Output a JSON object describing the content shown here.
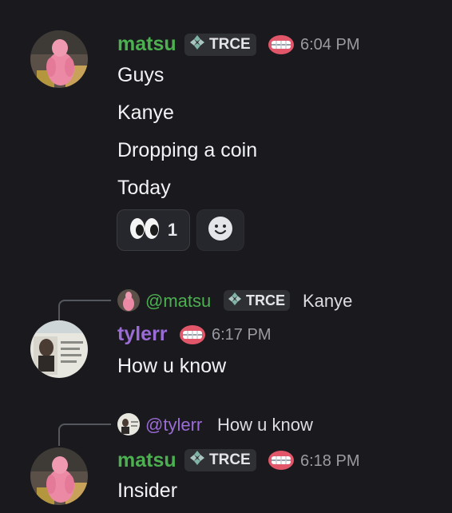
{
  "messages": [
    {
      "username": "matsu",
      "tag": "TRCE",
      "time": "6:04 PM",
      "lines": [
        "Guys",
        "Kanye",
        "Dropping a coin",
        "Today"
      ],
      "reaction": {
        "emoji": "eyes-emoji",
        "count": "1"
      },
      "add_reaction_icon": "smiley-icon"
    },
    {
      "reply_to": {
        "name": "@matsu",
        "tag": "TRCE",
        "text": "Kanye"
      },
      "username": "tylerr",
      "time": "6:17 PM",
      "lines": [
        "How u know"
      ]
    },
    {
      "reply_to": {
        "name": "@tylerr",
        "text": "How u know"
      },
      "username": "matsu",
      "tag": "TRCE",
      "time": "6:18 PM",
      "lines": [
        "Insider"
      ]
    }
  ],
  "colors": {
    "background": "#1a1a1e",
    "matsu_name": "#4caf50",
    "tylerr_name": "#9b6bd6"
  }
}
